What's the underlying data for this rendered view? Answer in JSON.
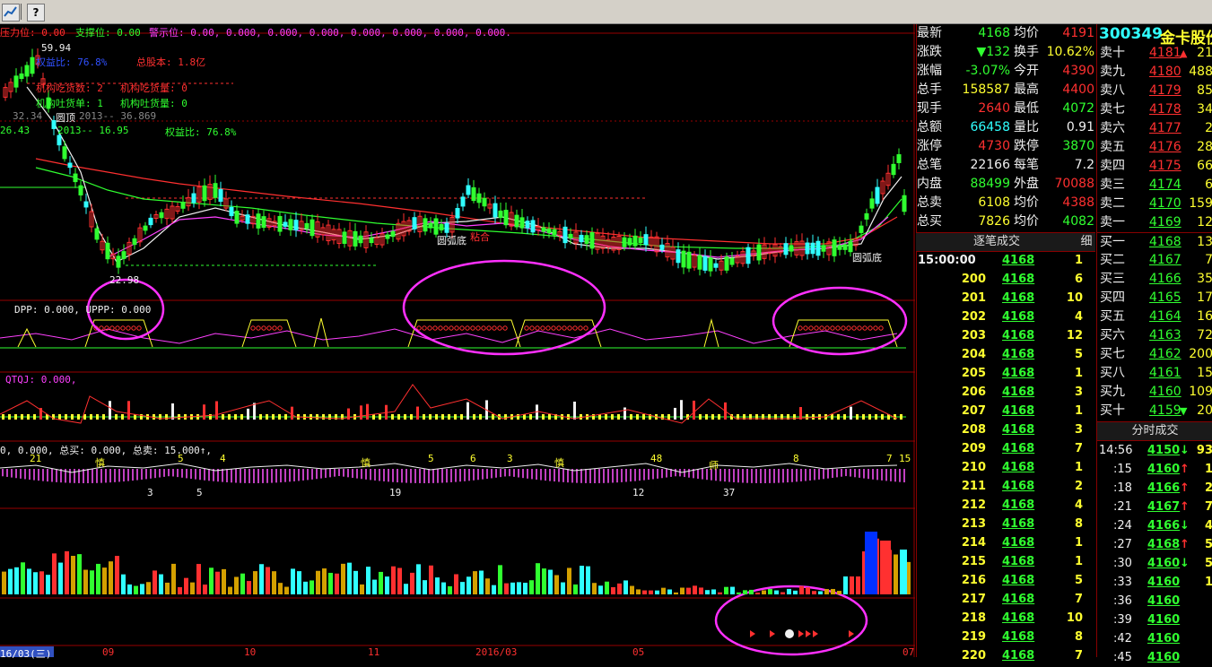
{
  "toolbar": {
    "btn1_icon": "chart-icon",
    "btn2_glyph": "?"
  },
  "chart_labels": {
    "line1_a": "压力位: 0.00",
    "line1_b": "支撑位: 0.00",
    "line1_c": "警示位: 0.00, 0.000, 0.000, 0.000, 0.000, 0.000, 0.000, 0.000.",
    "high_mark": "59.94",
    "ratio_top": "权益比: 76.8%",
    "total_shares": "总股本: 1.8亿",
    "inst_buy": "机构吃货数: 2",
    "inst_buy2": "机构吃货量: 0",
    "inst_sell": "机构吐货单: 1",
    "inst_sell2": "机构吐货量: 0",
    "eq1": "32.34",
    "circle_top": "圆顶",
    "eq1b": "2013-- 36.869",
    "eq2": "26.43",
    "eq2b": "2013-- 16.95",
    "eq2c": "权益比: 76.8%",
    "low_mark": "22.98",
    "arc_bottom1": "圆弧底",
    "arc_bottom2": "圆弧底",
    "gold_cross": "粘合",
    "ind1": "DPP: 0.000, UPPP: 0.000",
    "ind2": "QTQJ: 0.000,",
    "ind3": "0, 0.000, 总买: 0.000, 总卖: 15.000↑,",
    "date_left": "16/03(三)",
    "x_09": "09",
    "x_10": "10",
    "x_11": "11",
    "x_2016": "2016/03",
    "x_05": "05",
    "x_07": "07",
    "n21": "21",
    "n5": "5",
    "n4": "4",
    "n6": "6",
    "n3": "3",
    "n48": "48",
    "n8": "8",
    "n7": "7",
    "n15": "15",
    "n19": "19",
    "n12": "12",
    "n37": "37",
    "shen": "慎",
    "shi": "师"
  },
  "stock": {
    "code": "300349",
    "name": "金卡股份"
  },
  "quote": [
    {
      "label": "最新",
      "value": "4168",
      "label2": "均价",
      "value2": "4191",
      "c1": "#30ff30",
      "c2": "#ff3030"
    },
    {
      "label": "涨跌",
      "value": "▼132",
      "label2": "换手",
      "value2": "10.62%",
      "c1": "#30ff30",
      "c2": "#ffff30"
    },
    {
      "label": "涨幅",
      "value": "-3.07%",
      "label2": "今开",
      "value2": "4390",
      "c1": "#30ff30",
      "c2": "#ff3030"
    },
    {
      "label": "总手",
      "value": "158587",
      "label2": "最高",
      "value2": "4400",
      "c1": "#ffff30",
      "c2": "#ff3030"
    },
    {
      "label": "现手",
      "value": "2640",
      "label2": "最低",
      "value2": "4072",
      "c1": "#ff3030",
      "c2": "#30ff30"
    },
    {
      "label": "总额",
      "value": "66458",
      "label2": "量比",
      "value2": "0.91",
      "c1": "#30ffff",
      "c2": "#f0f0f0"
    },
    {
      "label": "涨停",
      "value": "4730",
      "label2": "跌停",
      "value2": "3870",
      "c1": "#ff3030",
      "c2": "#30ff30"
    },
    {
      "label": "总笔",
      "value": "22166",
      "label2": "每笔",
      "value2": "7.2",
      "c1": "#f0f0f0",
      "c2": "#f0f0f0"
    },
    {
      "label": "内盘",
      "value": "88499",
      "label2": "外盘",
      "value2": "70088",
      "c1": "#30ff30",
      "c2": "#ff3030"
    },
    {
      "label": "总卖",
      "value": "6108",
      "label2": "均价",
      "value2": "4388",
      "c1": "#ffff30",
      "c2": "#ff3030"
    },
    {
      "label": "总买",
      "value": "7826",
      "label2": "均价",
      "value2": "4082",
      "c1": "#ffff30",
      "c2": "#30ff30"
    }
  ],
  "ticks_header": "逐笔成交",
  "ticks_tab": "细",
  "ticks": [
    {
      "t": "15:00:00",
      "p": "4168",
      "v": "1"
    },
    {
      "t": "200",
      "p": "4168",
      "v": "6"
    },
    {
      "t": "201",
      "p": "4168",
      "v": "10"
    },
    {
      "t": "202",
      "p": "4168",
      "v": "4"
    },
    {
      "t": "203",
      "p": "4168",
      "v": "12"
    },
    {
      "t": "204",
      "p": "4168",
      "v": "5"
    },
    {
      "t": "205",
      "p": "4168",
      "v": "1"
    },
    {
      "t": "206",
      "p": "4168",
      "v": "3"
    },
    {
      "t": "207",
      "p": "4168",
      "v": "1"
    },
    {
      "t": "208",
      "p": "4168",
      "v": "3"
    },
    {
      "t": "209",
      "p": "4168",
      "v": "7"
    },
    {
      "t": "210",
      "p": "4168",
      "v": "1"
    },
    {
      "t": "211",
      "p": "4168",
      "v": "2"
    },
    {
      "t": "212",
      "p": "4168",
      "v": "4"
    },
    {
      "t": "213",
      "p": "4168",
      "v": "8"
    },
    {
      "t": "214",
      "p": "4168",
      "v": "1"
    },
    {
      "t": "215",
      "p": "4168",
      "v": "1"
    },
    {
      "t": "216",
      "p": "4168",
      "v": "5"
    },
    {
      "t": "217",
      "p": "4168",
      "v": "7"
    },
    {
      "t": "218",
      "p": "4168",
      "v": "10"
    },
    {
      "t": "219",
      "p": "4168",
      "v": "8"
    },
    {
      "t": "220",
      "p": "4168",
      "v": "7"
    }
  ],
  "book": [
    {
      "l": "卖十",
      "p": "4181",
      "v": "21",
      "m": "▲",
      "pc": "#ff3030"
    },
    {
      "l": "卖九",
      "p": "4180",
      "v": "488",
      "m": "",
      "pc": "#ff3030"
    },
    {
      "l": "卖八",
      "p": "4179",
      "v": "85",
      "m": "",
      "pc": "#ff3030"
    },
    {
      "l": "卖七",
      "p": "4178",
      "v": "34",
      "m": "",
      "pc": "#ff3030"
    },
    {
      "l": "卖六",
      "p": "4177",
      "v": "2",
      "m": "",
      "pc": "#ff3030"
    },
    {
      "l": "卖五",
      "p": "4176",
      "v": "28",
      "m": "",
      "pc": "#ff3030"
    },
    {
      "l": "卖四",
      "p": "4175",
      "v": "66",
      "m": "",
      "pc": "#ff3030"
    },
    {
      "l": "卖三",
      "p": "4174",
      "v": "6",
      "m": "",
      "pc": "#30ff30"
    },
    {
      "l": "卖二",
      "p": "4170",
      "v": "159",
      "m": "",
      "pc": "#30ff30"
    },
    {
      "l": "卖一",
      "p": "4169",
      "v": "12",
      "m": "",
      "pc": "#30ff30"
    },
    {
      "l": "买一",
      "p": "4168",
      "v": "13",
      "m": "",
      "pc": "#30ff30"
    },
    {
      "l": "买二",
      "p": "4167",
      "v": "7",
      "m": "",
      "pc": "#30ff30"
    },
    {
      "l": "买三",
      "p": "4166",
      "v": "35",
      "m": "",
      "pc": "#30ff30"
    },
    {
      "l": "买四",
      "p": "4165",
      "v": "17",
      "m": "",
      "pc": "#30ff30"
    },
    {
      "l": "买五",
      "p": "4164",
      "v": "16",
      "m": "",
      "pc": "#30ff30"
    },
    {
      "l": "买六",
      "p": "4163",
      "v": "72",
      "m": "",
      "pc": "#30ff30"
    },
    {
      "l": "买七",
      "p": "4162",
      "v": "200",
      "m": "",
      "pc": "#30ff30"
    },
    {
      "l": "买八",
      "p": "4161",
      "v": "15",
      "m": "",
      "pc": "#30ff30"
    },
    {
      "l": "买九",
      "p": "4160",
      "v": "109",
      "m": "",
      "pc": "#30ff30"
    },
    {
      "l": "买十",
      "p": "4159",
      "v": "20",
      "m": "▼",
      "pc": "#30ff30"
    }
  ],
  "intraday_header": "分时成交",
  "intraday": [
    {
      "t": "14:56",
      "p": "4150",
      "a": "↓",
      "v": "93",
      "ac": "#30ff30"
    },
    {
      "t": ":15",
      "p": "4160",
      "a": "↑",
      "v": "1",
      "ac": "#ff3030"
    },
    {
      "t": ":18",
      "p": "4166",
      "a": "↑",
      "v": "2",
      "ac": "#ff3030"
    },
    {
      "t": ":21",
      "p": "4167",
      "a": "↑",
      "v": "7",
      "ac": "#ff3030"
    },
    {
      "t": ":24",
      "p": "4166",
      "a": "↓",
      "v": "4",
      "ac": "#30ff30"
    },
    {
      "t": ":27",
      "p": "4168",
      "a": "↑",
      "v": "5",
      "ac": "#ff3030"
    },
    {
      "t": ":30",
      "p": "4160",
      "a": "↓",
      "v": "5",
      "ac": "#30ff30"
    },
    {
      "t": ":33",
      "p": "4160",
      "a": "",
      "v": "1",
      "ac": "#30ff30"
    },
    {
      "t": ":36",
      "p": "4160",
      "a": "",
      "v": "",
      "ac": "#30ff30"
    },
    {
      "t": ":39",
      "p": "4160",
      "a": "",
      "v": "",
      "ac": "#30ff30"
    },
    {
      "t": ":42",
      "p": "4160",
      "a": "",
      "v": "",
      "ac": "#30ff30"
    },
    {
      "t": ":45",
      "p": "4160",
      "a": "",
      "v": "",
      "ac": "#30ff30"
    }
  ]
}
